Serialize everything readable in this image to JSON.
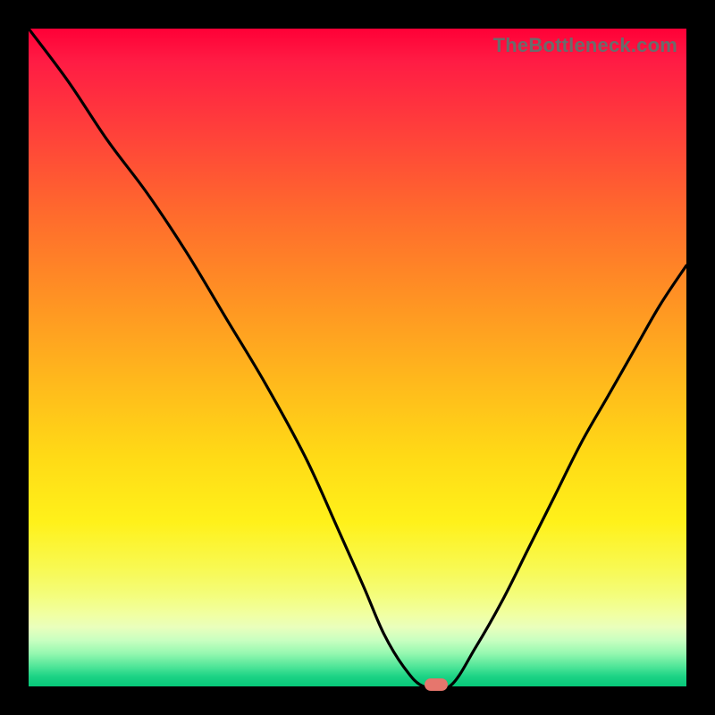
{
  "watermark": {
    "text": "TheBottleneck.com"
  },
  "colors": {
    "frame_bg": "#000000",
    "curve_stroke": "#000000",
    "marker_fill": "#e6766d",
    "gradient_top": "#ff0037",
    "gradient_bottom": "#07c879"
  },
  "chart_data": {
    "type": "line",
    "title": "",
    "xlabel": "",
    "ylabel": "",
    "xlim": [
      0,
      100
    ],
    "ylim": [
      0,
      100
    ],
    "grid": false,
    "legend": false,
    "series": [
      {
        "name": "bottleneck-curve",
        "x": [
          0,
          6,
          12,
          18,
          24,
          30,
          36,
          42,
          47,
          51,
          54,
          57,
          60,
          64,
          68,
          72,
          76,
          80,
          84,
          88,
          92,
          96,
          100
        ],
        "y": [
          100,
          92,
          83,
          75,
          66,
          56,
          46,
          35,
          24,
          15,
          8,
          3,
          0,
          0,
          6,
          13,
          21,
          29,
          37,
          44,
          51,
          58,
          64
        ]
      }
    ],
    "annotations": [
      {
        "name": "optimal-marker",
        "x": 62,
        "y": 0,
        "shape": "pill",
        "color": "#e6766d"
      }
    ]
  }
}
